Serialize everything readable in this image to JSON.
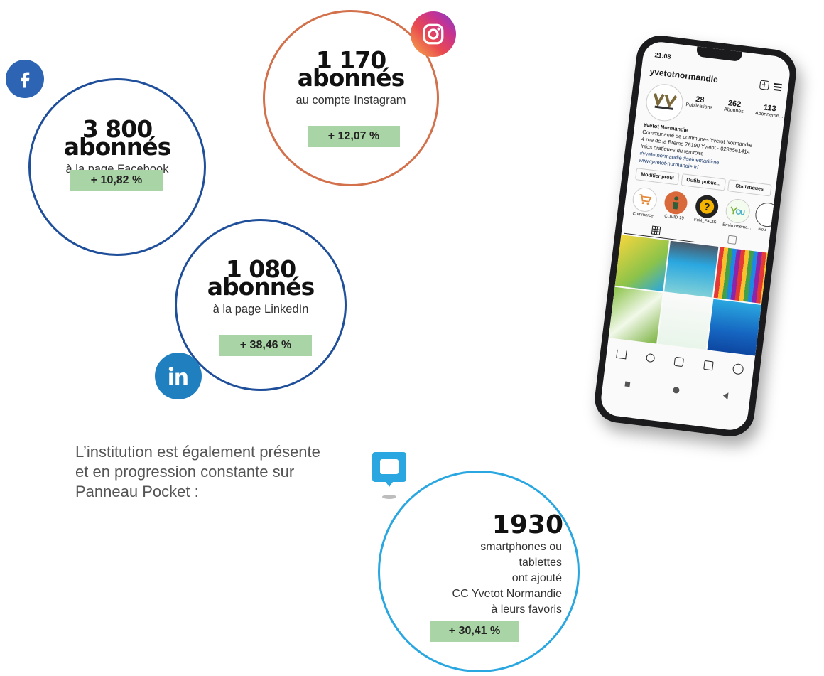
{
  "facebook": {
    "count": "3 800",
    "unit": "abonnés",
    "label": "à la page Facebook",
    "growth": "+ 10,82 %",
    "ring_color": "#1f4f9a",
    "icon": "facebook-icon"
  },
  "instagram": {
    "count": "1 170",
    "unit": "abonnés",
    "label": "au compte Instagram",
    "growth": "+ 12,07 %",
    "ring_color": "#d2714c",
    "icon": "instagram-icon"
  },
  "linkedin": {
    "count": "1 080",
    "unit": "abonnés",
    "label": "à la page LinkedIn",
    "growth": "+ 38,46 %",
    "ring_color": "#1f4f9a",
    "icon": "linkedin-icon"
  },
  "panneau": {
    "count": "1930",
    "lines": [
      "smartphones ou",
      "tablettes",
      "ont ajouté",
      "CC Yvetot Normandie",
      "à leurs favoris"
    ],
    "growth": "+ 30,41 %",
    "ring_color": "#2aa7e0",
    "icon": "panneau-pocket-icon"
  },
  "intro_text": [
    "L’institution est également présente",
    "et en progression constante sur",
    "Panneau Pocket :"
  ],
  "phone": {
    "time": "21:08",
    "username": "yvetotnormandie",
    "stats": [
      {
        "value": "28",
        "label": "Publications"
      },
      {
        "value": "262",
        "label": "Abonnés"
      },
      {
        "value": "113",
        "label": "Abonneme..."
      }
    ],
    "bio_name": "Yvetot Normandie",
    "bio_lines": [
      "Communauté de communes Yvetot Normandie",
      "4 rue de la Brême 76190 Yvetot - 0235561414",
      "Infos pratiques du territoire",
      "#yvetotnormandie #seinemaritime",
      "www.yvetot-normandie.fr/"
    ],
    "buttons": [
      "Modifier profil",
      "Outils public...",
      "Statistiques"
    ],
    "highlights": [
      "Commerce",
      "COVID-19",
      "FuN_FaCtS",
      "Environneme...",
      "Nou"
    ]
  }
}
